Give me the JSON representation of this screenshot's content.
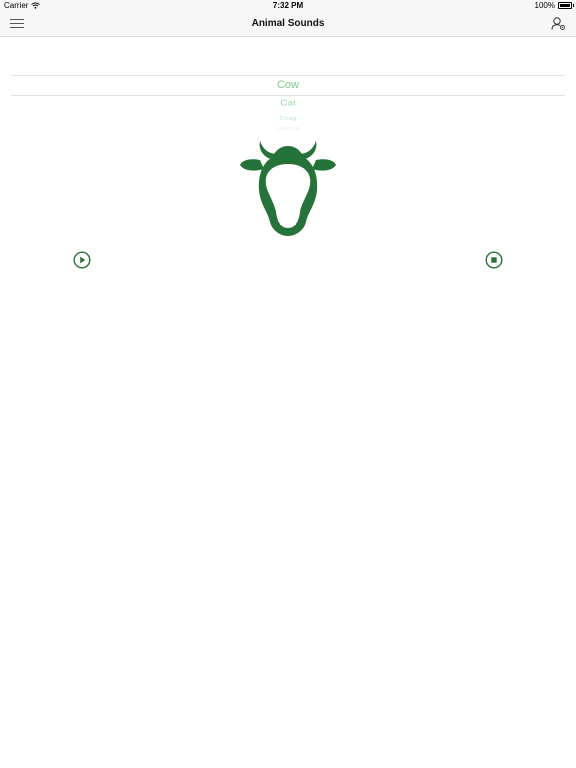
{
  "status_bar": {
    "carrier": "Carrier",
    "time": "7:32 PM",
    "battery_percent": "100%",
    "battery_level": 1.0,
    "wifi_icon": "wifi-icon",
    "battery_icon": "battery-icon"
  },
  "nav": {
    "title": "Animal Sounds",
    "menu_icon": "hamburger-menu-icon",
    "profile_icon": "user-gear-icon"
  },
  "picker": {
    "items": [
      "Cow",
      "Cat",
      "Dog",
      "Rabbit"
    ],
    "selected": "Cow"
  },
  "animal": {
    "icon": "cow-head-icon",
    "color": "#267339"
  },
  "controls": {
    "play_icon": "play-icon",
    "stop_icon": "stop-icon",
    "color": "#267339"
  },
  "colors": {
    "accent": "#267339",
    "picker_text": "#7cc98a"
  }
}
